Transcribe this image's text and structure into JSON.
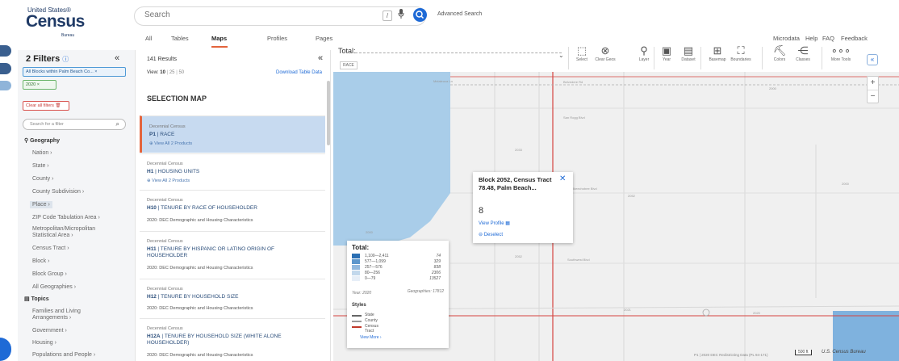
{
  "logo": {
    "line1": "United States®",
    "line2": "Census",
    "line3": "Bureau"
  },
  "search": {
    "placeholder": "Search",
    "shortcut": "/",
    "advanced": "Advanced Search"
  },
  "tabs": [
    {
      "label": "All"
    },
    {
      "label": "Tables"
    },
    {
      "label": "Maps"
    },
    {
      "label": "Profiles"
    },
    {
      "label": "Pages"
    }
  ],
  "right_links": {
    "microdata": "Microdata",
    "help": "Help",
    "faq": "FAQ",
    "feedback": "Feedback"
  },
  "left_panel": {
    "filters_title": "2 Filters",
    "chips": [
      "All Blocks within Palm Beach Co...",
      "2020"
    ],
    "clear_all": "Clear all filters",
    "search_placeholder": "Search for a filter",
    "geography_title": "Geography",
    "geography_items": [
      "Nation",
      "State",
      "County",
      "County Subdivision",
      "Place",
      "ZIP Code Tabulation Area",
      "Metropolitan/Micropolitan",
      "Statistical Area",
      "Census Tract",
      "Block",
      "Block Group",
      "All Geographies"
    ],
    "topics_title": "Topics",
    "topic_items": [
      "Families and Living",
      "Arrangements",
      "Government",
      "Housing",
      "Populations and People"
    ]
  },
  "results": {
    "count": "141 Results",
    "view_label": "View:",
    "view_options": [
      "10",
      "25",
      "50"
    ],
    "download": "Download Table Data",
    "selection_map": "SELECTION MAP",
    "cards": [
      {
        "kind": "Decennial Census",
        "code": "P1",
        "title": "RACE",
        "sub": "View All 2 Products"
      },
      {
        "kind": "Decennial Census",
        "code": "H1",
        "title": "HOUSING UNITS",
        "sub": "View All 2 Products"
      },
      {
        "kind": "Decennial Census",
        "code": "H10",
        "title": "TENURE BY RACE OF HOUSEHOLDER",
        "sub": "2020: DEC Demographic and Housing Characteristics"
      },
      {
        "kind": "Decennial Census",
        "code": "H11",
        "title": "TENURE BY HISPANIC OR LATINO ORIGIN OF",
        "title2": "HOUSEHOLDER",
        "sub": "2020: DEC Demographic and Housing Characteristics"
      },
      {
        "kind": "Decennial Census",
        "code": "H12",
        "title": "TENURE BY HOUSEHOLD SIZE",
        "sub": "2020: DEC Demographic and Housing Characteristics"
      },
      {
        "kind": "Decennial Census",
        "code": "H12A",
        "title": "TENURE BY HOUSEHOLD SIZE (WHITE ALONE",
        "title2": "HOUSEHOLDER)",
        "sub": "2020: DEC Demographic and Housing Characteristics"
      }
    ]
  },
  "map_toolbar": {
    "total": "Total:",
    "tag": "RACE",
    "tools": [
      "Select",
      "Clear Geos",
      "Layer",
      "Year",
      "Dataset",
      "Basemap",
      "Boundaries",
      "Colors",
      "Classes",
      "More Tools"
    ]
  },
  "map": {
    "streets": [
      "Melaleuca Ln",
      "Belvedere Rd",
      "San Rogg Blvd",
      "Okeechobee Blvd",
      "Southwest Blvd"
    ],
    "labels": [
      "2000",
      "2000",
      "2033",
      "2052",
      "2052",
      "2021",
      "2020",
      "2000"
    ]
  },
  "popup": {
    "title": "Block 2052, Census Tract 78.48, Palm Beach...",
    "value": "8",
    "view_profile": "View Profile",
    "deselect": "Deselect"
  },
  "legend": {
    "title": "Total:",
    "ranges": [
      {
        "range": "1,100—2,411",
        "count": "74",
        "color": "#2b6fb3"
      },
      {
        "range": "577—1,099",
        "count": "329",
        "color": "#5d97cc"
      },
      {
        "range": "257—576",
        "count": "838",
        "color": "#92b9de"
      },
      {
        "range": "80—256",
        "count": "2306",
        "color": "#c2d8ec"
      },
      {
        "range": "0—79",
        "count": "13527",
        "color": "#e6eef7"
      }
    ],
    "year": "Year: 2020",
    "geographies": "Geographies: 17812",
    "styles_title": "Styles",
    "styles": [
      {
        "label": "State",
        "color": "#666666"
      },
      {
        "label": "County",
        "color": "#999999"
      },
      {
        "label": "Census Tract",
        "color": "#c0392b"
      }
    ],
    "view_more": "View More"
  },
  "footer": {
    "attribution": "P1 | 2020 DEC Redistricting Data (PL 94-171)",
    "scale": "500 ft",
    "credit": "U.S. Census Bureau"
  }
}
